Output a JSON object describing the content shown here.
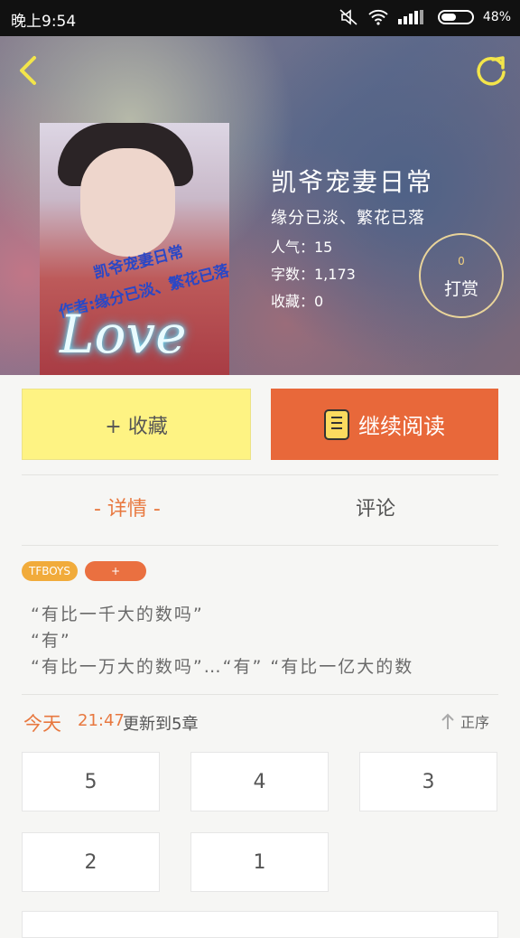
{
  "status_bar": {
    "time": "晚上9:54",
    "battery": "48%",
    "battery_level": 0.48
  },
  "book": {
    "title": "凯爷宠妻日常",
    "subtitle": "缘分已淡、繁花已落",
    "stats": {
      "popularity": "人气：15",
      "words": "字数：1,173",
      "favorites": "收藏：0"
    },
    "cover": {
      "line1": "凯爷宠妻日常",
      "line2": "作者:缘分已淡、繁花已落",
      "art_text": "Love"
    }
  },
  "tip": {
    "count": "0",
    "label": "打赏"
  },
  "actions": {
    "favorite": "+ 收藏",
    "continue_reading": "继续阅读"
  },
  "tabs": [
    {
      "label": "- 详情 -",
      "active": true
    },
    {
      "label": "评论",
      "active": false
    }
  ],
  "tags": [
    "TFBOYS",
    "+"
  ],
  "description": [
    "“有比一千大的数吗”",
    "“有”",
    "“有比一万大的数吗”…“有” “有比一亿大的数"
  ],
  "update": {
    "day": "今天",
    "time": "21:47",
    "text": "更新到5章"
  },
  "sort_label": "正序",
  "chapters": [
    "5",
    "4",
    "3",
    "2",
    "1"
  ],
  "colors": {
    "accent_orange": "#e8683a",
    "yellow": "#fef383",
    "tag_yellow": "#f1ab3b",
    "tip_ring": "#e9d49a"
  }
}
